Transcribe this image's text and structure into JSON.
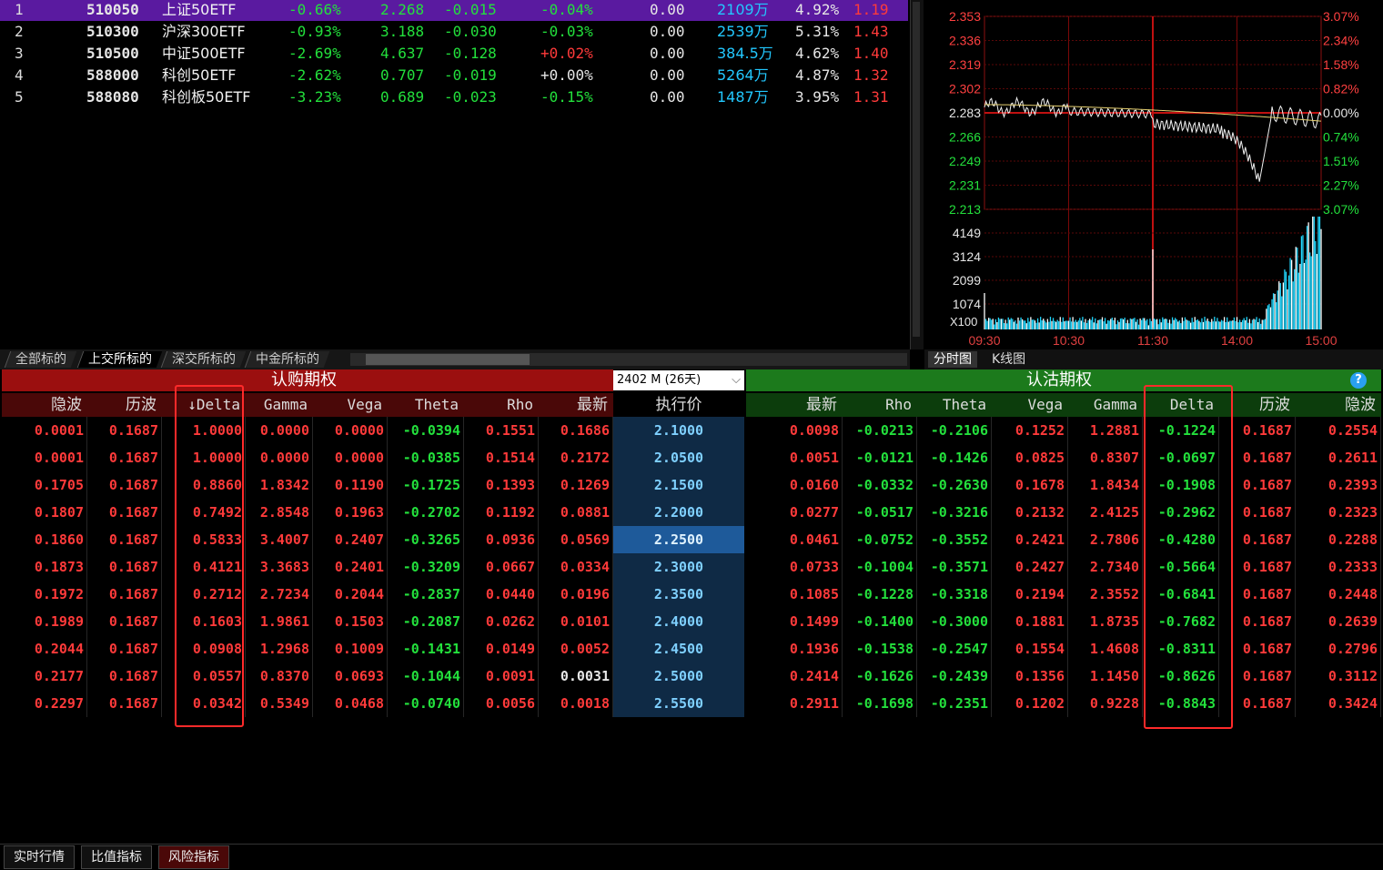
{
  "etf_list": [
    {
      "idx": "1",
      "code": "510050",
      "name": "上证50ETF",
      "chg": "-0.66%",
      "price": "2.268",
      "diff": "-0.015",
      "speed": "-0.04%",
      "x": "0.00",
      "amount": "2109万",
      "amp": "4.92%",
      "ratio": "1.19"
    },
    {
      "idx": "2",
      "code": "510300",
      "name": "沪深300ETF",
      "chg": "-0.93%",
      "price": "3.188",
      "diff": "-0.030",
      "speed": "-0.03%",
      "x": "0.00",
      "amount": "2539万",
      "amp": "5.31%",
      "ratio": "1.43"
    },
    {
      "idx": "3",
      "code": "510500",
      "name": "中证500ETF",
      "chg": "-2.69%",
      "price": "4.637",
      "diff": "-0.128",
      "speed": "+0.02%",
      "x": "0.00",
      "amount": "384.5万",
      "amp": "4.62%",
      "ratio": "1.40"
    },
    {
      "idx": "4",
      "code": "588000",
      "name": "科创50ETF",
      "chg": "-2.62%",
      "price": "0.707",
      "diff": "-0.019",
      "speed": "+0.00%",
      "x": "0.00",
      "amount": "5264万",
      "amp": "4.87%",
      "ratio": "1.32"
    },
    {
      "idx": "5",
      "code": "588080",
      "name": "科创板50ETF",
      "chg": "-3.23%",
      "price": "0.689",
      "diff": "-0.023",
      "speed": "-0.15%",
      "x": "0.00",
      "amount": "1487万",
      "amp": "3.95%",
      "ratio": "1.31"
    }
  ],
  "market_tabs": [
    "全部标的",
    "上交所标的",
    "深交所标的",
    "中金所标的"
  ],
  "chart": {
    "price_ticks": [
      "2.353",
      "2.336",
      "2.319",
      "2.302",
      "2.283",
      "2.266",
      "2.249",
      "2.231",
      "2.213"
    ],
    "pct_ticks": [
      "3.07%",
      "2.34%",
      "1.58%",
      "0.82%",
      "0.00%",
      "0.74%",
      "1.51%",
      "2.27%",
      "3.07%"
    ],
    "vol_ticks": [
      "4149",
      "3124",
      "2099",
      "1074"
    ],
    "vol_unit": "X100",
    "time_ticks": [
      "09:30",
      "10:30",
      "11:30",
      "14:00",
      "15:00"
    ],
    "tabs": [
      "分时图",
      "K线图"
    ]
  },
  "options": {
    "call_title": "认购期权",
    "put_title": "认沽期权",
    "expiry_label": "2402 M (26天)",
    "help_icon": "?",
    "strike_header": "执行价",
    "call_headers": [
      "隐波",
      "历波",
      "↓Delta",
      "Gamma",
      "Vega",
      "Theta",
      "Rho",
      "最新"
    ],
    "put_headers": [
      "最新",
      "Rho",
      "Theta",
      "Vega",
      "Gamma",
      "Delta",
      "历波",
      "隐波"
    ],
    "rows": [
      {
        "strike": "2.1000",
        "call": [
          "0.0001",
          "0.1687",
          "1.0000",
          "0.0000",
          "0.0000",
          "-0.0394",
          "0.1551",
          "0.1686"
        ],
        "put": [
          "0.0098",
          "-0.0213",
          "-0.2106",
          "0.1252",
          "1.2881",
          "-0.1224",
          "0.1687",
          "0.2554"
        ]
      },
      {
        "strike": "2.0500",
        "call": [
          "0.0001",
          "0.1687",
          "1.0000",
          "0.0000",
          "0.0000",
          "-0.0385",
          "0.1514",
          "0.2172"
        ],
        "put": [
          "0.0051",
          "-0.0121",
          "-0.1426",
          "0.0825",
          "0.8307",
          "-0.0697",
          "0.1687",
          "0.2611"
        ]
      },
      {
        "strike": "2.1500",
        "call": [
          "0.1705",
          "0.1687",
          "0.8860",
          "1.8342",
          "0.1190",
          "-0.1725",
          "0.1393",
          "0.1269"
        ],
        "put": [
          "0.0160",
          "-0.0332",
          "-0.2630",
          "0.1678",
          "1.8434",
          "-0.1908",
          "0.1687",
          "0.2393"
        ]
      },
      {
        "strike": "2.2000",
        "call": [
          "0.1807",
          "0.1687",
          "0.7492",
          "2.8548",
          "0.1963",
          "-0.2702",
          "0.1192",
          "0.0881"
        ],
        "put": [
          "0.0277",
          "-0.0517",
          "-0.3216",
          "0.2132",
          "2.4125",
          "-0.2962",
          "0.1687",
          "0.2323"
        ]
      },
      {
        "strike": "2.2500",
        "call": [
          "0.1860",
          "0.1687",
          "0.5833",
          "3.4007",
          "0.2407",
          "-0.3265",
          "0.0936",
          "0.0569"
        ],
        "put": [
          "0.0461",
          "-0.0752",
          "-0.3552",
          "0.2421",
          "2.7806",
          "-0.4280",
          "0.1687",
          "0.2288"
        ]
      },
      {
        "strike": "2.3000",
        "call": [
          "0.1873",
          "0.1687",
          "0.4121",
          "3.3683",
          "0.2401",
          "-0.3209",
          "0.0667",
          "0.0334"
        ],
        "put": [
          "0.0733",
          "-0.1004",
          "-0.3571",
          "0.2427",
          "2.7340",
          "-0.5664",
          "0.1687",
          "0.2333"
        ]
      },
      {
        "strike": "2.3500",
        "call": [
          "0.1972",
          "0.1687",
          "0.2712",
          "2.7234",
          "0.2044",
          "-0.2837",
          "0.0440",
          "0.0196"
        ],
        "put": [
          "0.1085",
          "-0.1228",
          "-0.3318",
          "0.2194",
          "2.3552",
          "-0.6841",
          "0.1687",
          "0.2448"
        ]
      },
      {
        "strike": "2.4000",
        "call": [
          "0.1989",
          "0.1687",
          "0.1603",
          "1.9861",
          "0.1503",
          "-0.2087",
          "0.0262",
          "0.0101"
        ],
        "put": [
          "0.1499",
          "-0.1400",
          "-0.3000",
          "0.1881",
          "1.8735",
          "-0.7682",
          "0.1687",
          "0.2639"
        ]
      },
      {
        "strike": "2.4500",
        "call": [
          "0.2044",
          "0.1687",
          "0.0908",
          "1.2968",
          "0.1009",
          "-0.1431",
          "0.0149",
          "0.0052"
        ],
        "put": [
          "0.1936",
          "-0.1538",
          "-0.2547",
          "0.1554",
          "1.4608",
          "-0.8311",
          "0.1687",
          "0.2796"
        ]
      },
      {
        "strike": "2.5000",
        "call": [
          "0.2177",
          "0.1687",
          "0.0557",
          "0.8370",
          "0.0693",
          "-0.1044",
          "0.0091",
          "0.0031"
        ],
        "put": [
          "0.2414",
          "-0.1626",
          "-0.2439",
          "0.1356",
          "1.1450",
          "-0.8626",
          "0.1687",
          "0.3112"
        ]
      },
      {
        "strike": "2.5500",
        "call": [
          "0.2297",
          "0.1687",
          "0.0342",
          "0.5349",
          "0.0468",
          "-0.0740",
          "0.0056",
          "0.0018"
        ],
        "put": [
          "0.2911",
          "-0.1698",
          "-0.2351",
          "0.1202",
          "0.9228",
          "-0.8843",
          "0.1687",
          "0.3424"
        ]
      }
    ]
  },
  "bottom_tabs": [
    "实时行情",
    "比值指标",
    "风险指标"
  ],
  "colors": {
    "up": "#ff3a3a",
    "down": "#23e03c",
    "accent_call": "#9b0f0f",
    "accent_put": "#1c7a1c"
  }
}
